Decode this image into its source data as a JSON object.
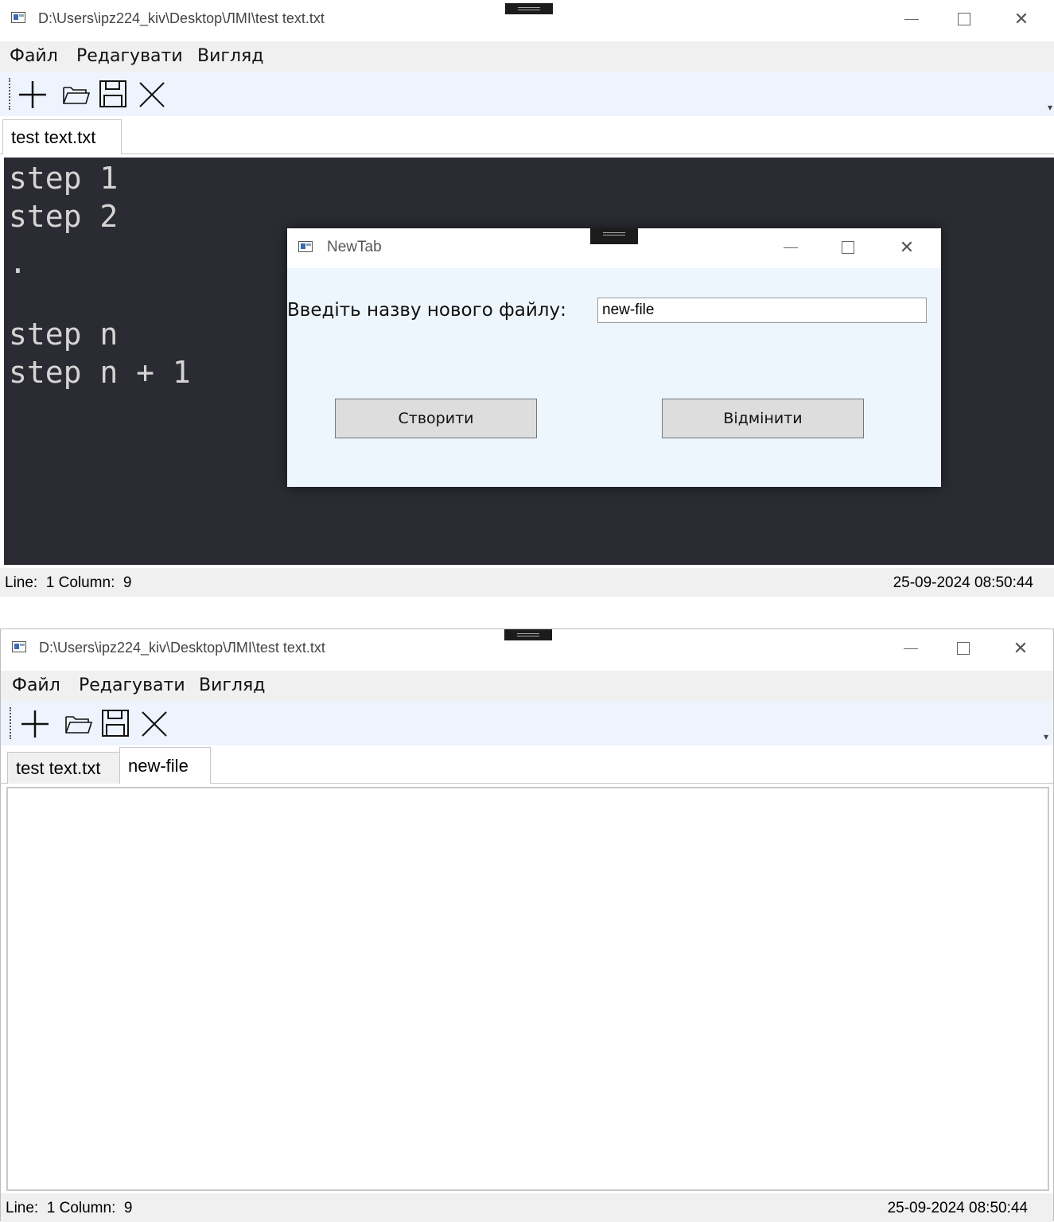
{
  "window1": {
    "title": "D:\\Users\\ipz224_kiv\\Desktop\\ЛМІ\\test text.txt",
    "close_glyph": "✕",
    "menu": [
      "Файл",
      "Редагувати",
      "Вигляд"
    ],
    "toolbar": {
      "icons": [
        "plus-icon",
        "folder-open-icon",
        "save-icon",
        "close-icon"
      ],
      "overflow_glyph": "▾"
    },
    "tabs": [
      {
        "label": "test text.txt",
        "active": true
      }
    ],
    "editor": {
      "theme_background": "#2b2b33",
      "lines": [
        "step 1",
        "step 2",
        ".",
        "",
        "step n",
        "step n + 1"
      ]
    },
    "status": {
      "left": "Line:  1 Column:  9",
      "right": "25-09-2024 08:50:44"
    },
    "dialog": {
      "title": "NewTab",
      "close_glyph": "✕",
      "prompt": "Введіть назву нового файлу:",
      "input_value": "new-file",
      "create_label": "Створити",
      "cancel_label": "Відмінити"
    }
  },
  "window2": {
    "title": "D:\\Users\\ipz224_kiv\\Desktop\\ЛМІ\\test text.txt",
    "close_glyph": "✕",
    "menu": [
      "Файл",
      "Редагувати",
      "Вигляд"
    ],
    "toolbar": {
      "icons": [
        "plus-icon",
        "folder-open-icon",
        "save-icon",
        "close-icon"
      ],
      "overflow_glyph": "▾"
    },
    "tabs": [
      {
        "label": "test text.txt",
        "active": false
      },
      {
        "label": "new-file",
        "active": true
      }
    ],
    "editor": {
      "content": ""
    },
    "status": {
      "left": "Line:  1 Column:  9",
      "right": "25-09-2024 08:50:44"
    }
  }
}
